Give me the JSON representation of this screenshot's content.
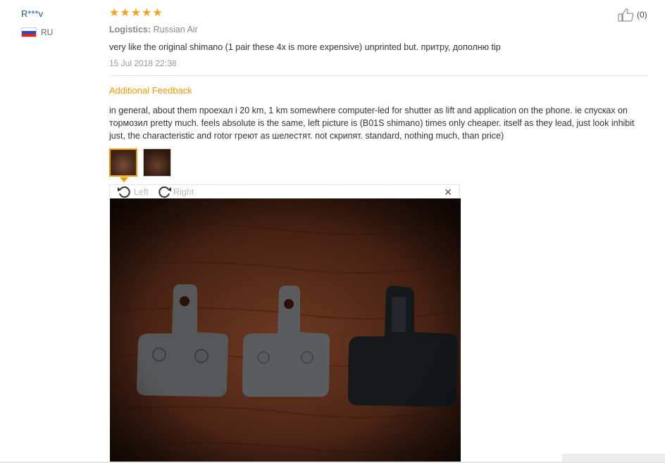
{
  "reviewer": {
    "name": "R***v",
    "country_code": "RU",
    "flag_colors": [
      "#ffffff",
      "#2a4bbf",
      "#d52b1e"
    ]
  },
  "review": {
    "rating": 5,
    "star_color": "#f7a21b",
    "logistics_label": "Logistics:",
    "logistics_value": "Russian Air",
    "text": "very like the original shimano (1 pair these 4x is more expensive) unprinted but. притру, дополню tip",
    "date": "15 Jul 2018 22:38",
    "helpful_icon": "thumbs-up-icon",
    "helpful_count": "(0)"
  },
  "additional_feedback": {
    "title": "Additional Feedback",
    "text": "in general, about them проехал i 20 km, 1 km somewhere computer-led for shutter as lift and application on the phone. ie спускax on тормозил pretty much. feels absolute is the same, left picture is (B01S shimano) times only cheaper. itself as they lead, just look inhibit just, the characteristic and rotor греют as шелестят. not скрипят. standard, nothing much, than price)",
    "accent_color": "#f39800"
  },
  "viewer": {
    "rotate_left_label": "Left",
    "rotate_right_label": "Right",
    "close_icon": "close-icon",
    "photo_description_icon": "brake-pads-photo"
  }
}
